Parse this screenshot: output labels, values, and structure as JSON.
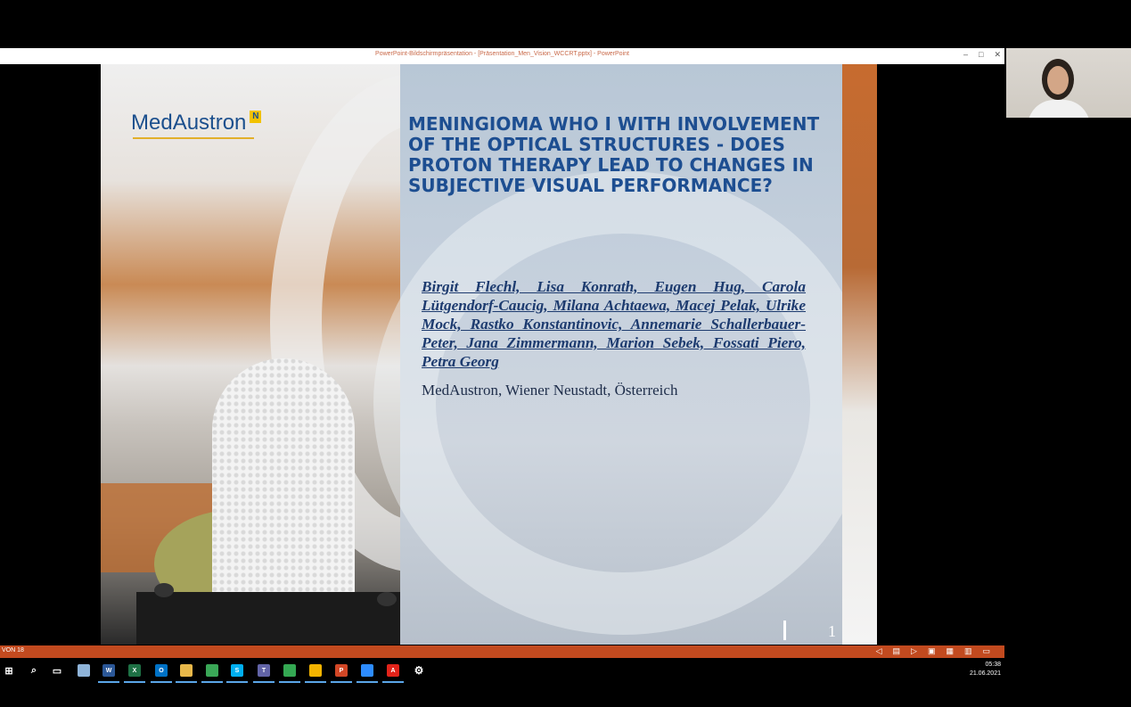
{
  "window": {
    "title": "PowerPoint-Bildschirmpräsentation - [Präsentation_Men_Vision_WCCRT.pptx] - PowerPoint",
    "controls": [
      "–",
      "□",
      "✕"
    ]
  },
  "slide": {
    "logo_text": "MedAustron",
    "logo_badge": "N",
    "title": "MENINGIOMA WHO I WITH INVOLVEMENT OF THE OPTICAL STRUCTURES - DOES PROTON THERAPY LEAD TO CHANGES IN SUBJECTIVE VISUAL PERFORMANCE?",
    "authors": "Birgit Flechl, Lisa Konrath, Eugen Hug, Carola Lütgendorf-Caucig, Milana Achtaewa, Macej Pelak, Ulrike Mock, Rastko Konstantinovic, Annemarie Schallerbauer-Peter, Jana Zimmermann, Marion Sebek, Fossati Piero, Petra Georg",
    "affiliation": "MedAustron, Wiener Neustadt, Österreich",
    "number": "1"
  },
  "statusbar": {
    "slide_count": "VON 18",
    "icons": [
      "prev-icon",
      "notes-icon",
      "next-icon",
      "normal-view-icon",
      "sorter-view-icon",
      "reading-view-icon",
      "slideshow-icon"
    ]
  },
  "taskbar": {
    "time": "05:38",
    "date": "21.06.2021",
    "apps": [
      {
        "name": "start",
        "glyph": "⊞",
        "color": "#ffffff"
      },
      {
        "name": "search",
        "glyph": "⌕",
        "color": "#ffffff"
      },
      {
        "name": "task-view",
        "glyph": "▭",
        "color": "#ffffff"
      },
      {
        "name": "file",
        "glyph": "",
        "color": "#8fb4d9"
      },
      {
        "name": "word",
        "glyph": "W",
        "color": "#2b5797"
      },
      {
        "name": "excel",
        "glyph": "X",
        "color": "#1e7145"
      },
      {
        "name": "outlook",
        "glyph": "O",
        "color": "#0072c6"
      },
      {
        "name": "explorer",
        "glyph": "",
        "color": "#e8b84a"
      },
      {
        "name": "chrome-green",
        "glyph": "",
        "color": "#3aa757"
      },
      {
        "name": "skype",
        "glyph": "S",
        "color": "#00aff0"
      },
      {
        "name": "teams",
        "glyph": "T",
        "color": "#6264a7"
      },
      {
        "name": "app-green",
        "glyph": "",
        "color": "#34a853"
      },
      {
        "name": "chrome",
        "glyph": "",
        "color": "#f4b400"
      },
      {
        "name": "powerpoint",
        "glyph": "P",
        "color": "#d24726"
      },
      {
        "name": "zoom",
        "glyph": "",
        "color": "#2d8cff"
      },
      {
        "name": "acrobat",
        "glyph": "A",
        "color": "#e2231a"
      },
      {
        "name": "settings",
        "glyph": "⚙",
        "color": "#000000"
      }
    ]
  }
}
